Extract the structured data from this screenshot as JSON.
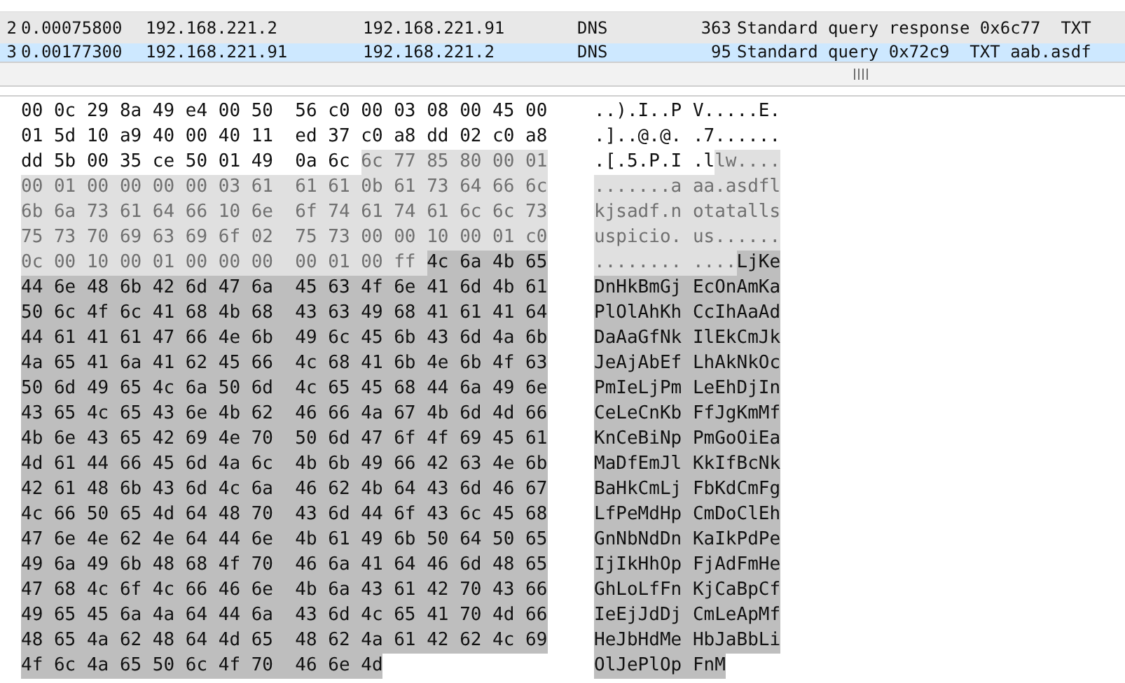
{
  "packet_list": {
    "rows": [
      {
        "no": "2",
        "time": "0.00075800",
        "source": "192.168.221.2",
        "destination": "192.168.221.91",
        "protocol": "DNS",
        "length": "363",
        "info": "Standard query response 0x6c77  TXT",
        "selected": false
      },
      {
        "no": "3",
        "time": "0.00177300",
        "source": "192.168.221.91",
        "destination": "192.168.221.2",
        "protocol": "DNS",
        "length": "95",
        "info": "Standard query 0x72c9  TXT aab.asdf",
        "selected": true
      }
    ]
  },
  "hex_dump": {
    "rows": [
      {
        "hex": [
          {
            "text": "00 0c 29 8a 49 e4 00 50  56 c0 00 03 08 00 45 00",
            "kind": "plain"
          }
        ],
        "ascii": [
          {
            "text": "..).I..P V.....E.",
            "kind": "plain"
          }
        ]
      },
      {
        "hex": [
          {
            "text": "01 5d 10 a9 40 00 40 11  ed 37 c0 a8 dd 02 c0 a8",
            "kind": "plain"
          }
        ],
        "ascii": [
          {
            "text": ".]..@.@. .7......",
            "kind": "plain"
          }
        ]
      },
      {
        "hex": [
          {
            "text": "dd 5b 00 35 ce 50 01 49  0a 6c ",
            "kind": "plain"
          },
          {
            "text": "6c 77 85 80 00 01",
            "kind": "field"
          }
        ],
        "ascii": [
          {
            "text": ".[.5.P.I .l",
            "kind": "plain"
          },
          {
            "text": "lw....",
            "kind": "field"
          }
        ]
      },
      {
        "hex": [
          {
            "text": "00 01 00 00 00 00 03 61  61 61 0b 61 73 64 66 6c",
            "kind": "field"
          }
        ],
        "ascii": [
          {
            "text": ".......a aa.asdfl",
            "kind": "field"
          }
        ]
      },
      {
        "hex": [
          {
            "text": "6b 6a 73 61 64 66 10 6e  6f 74 61 74 61 6c 6c 73",
            "kind": "field"
          }
        ],
        "ascii": [
          {
            "text": "kjsadf.n otatalls",
            "kind": "field"
          }
        ]
      },
      {
        "hex": [
          {
            "text": "75 73 70 69 63 69 6f 02  75 73 00 00 10 00 01 c0",
            "kind": "field"
          }
        ],
        "ascii": [
          {
            "text": "uspicio. us......",
            "kind": "field"
          }
        ]
      },
      {
        "hex": [
          {
            "text": "0c 00 10 00 01 00 00 00  00 01 00 ff ",
            "kind": "field"
          },
          {
            "text": "4c 6a 4b 65",
            "kind": "selected"
          }
        ],
        "ascii": [
          {
            "text": "........ ....",
            "kind": "field"
          },
          {
            "text": "LjKe",
            "kind": "selected"
          }
        ]
      },
      {
        "hex": [
          {
            "text": "44 6e 48 6b 42 6d 47 6a  45 63 4f 6e 41 6d 4b 61",
            "kind": "selected"
          }
        ],
        "ascii": [
          {
            "text": "DnHkBmGj EcOnAmKa",
            "kind": "selected"
          }
        ]
      },
      {
        "hex": [
          {
            "text": "50 6c 4f 6c 41 68 4b 68  43 63 49 68 41 61 41 64",
            "kind": "selected"
          }
        ],
        "ascii": [
          {
            "text": "PlOlAhKh CcIhAaAd",
            "kind": "selected"
          }
        ]
      },
      {
        "hex": [
          {
            "text": "44 61 41 61 47 66 4e 6b  49 6c 45 6b 43 6d 4a 6b",
            "kind": "selected"
          }
        ],
        "ascii": [
          {
            "text": "DaAaGfNk IlEkCmJk",
            "kind": "selected"
          }
        ]
      },
      {
        "hex": [
          {
            "text": "4a 65 41 6a 41 62 45 66  4c 68 41 6b 4e 6b 4f 63",
            "kind": "selected"
          }
        ],
        "ascii": [
          {
            "text": "JeAjAbEf LhAkNkOc",
            "kind": "selected"
          }
        ]
      },
      {
        "hex": [
          {
            "text": "50 6d 49 65 4c 6a 50 6d  4c 65 45 68 44 6a 49 6e",
            "kind": "selected"
          }
        ],
        "ascii": [
          {
            "text": "PmIeLjPm LeEhDjIn",
            "kind": "selected"
          }
        ]
      },
      {
        "hex": [
          {
            "text": "43 65 4c 65 43 6e 4b 62  46 66 4a 67 4b 6d 4d 66",
            "kind": "selected"
          }
        ],
        "ascii": [
          {
            "text": "CeLeCnKb FfJgKmMf",
            "kind": "selected"
          }
        ]
      },
      {
        "hex": [
          {
            "text": "4b 6e 43 65 42 69 4e 70  50 6d 47 6f 4f 69 45 61",
            "kind": "selected"
          }
        ],
        "ascii": [
          {
            "text": "KnCeBiNp PmGoOiEa",
            "kind": "selected"
          }
        ]
      },
      {
        "hex": [
          {
            "text": "4d 61 44 66 45 6d 4a 6c  4b 6b 49 66 42 63 4e 6b",
            "kind": "selected"
          }
        ],
        "ascii": [
          {
            "text": "MaDfEmJl KkIfBcNk",
            "kind": "selected"
          }
        ]
      },
      {
        "hex": [
          {
            "text": "42 61 48 6b 43 6d 4c 6a  46 62 4b 64 43 6d 46 67",
            "kind": "selected"
          }
        ],
        "ascii": [
          {
            "text": "BaHkCmLj FbKdCmFg",
            "kind": "selected"
          }
        ]
      },
      {
        "hex": [
          {
            "text": "4c 66 50 65 4d 64 48 70  43 6d 44 6f 43 6c 45 68",
            "kind": "selected"
          }
        ],
        "ascii": [
          {
            "text": "LfPeMdHp CmDoClEh",
            "kind": "selected"
          }
        ]
      },
      {
        "hex": [
          {
            "text": "47 6e 4e 62 4e 64 44 6e  4b 61 49 6b 50 64 50 65",
            "kind": "selected"
          }
        ],
        "ascii": [
          {
            "text": "GnNbNdDn KaIkPdPe",
            "kind": "selected"
          }
        ]
      },
      {
        "hex": [
          {
            "text": "49 6a 49 6b 48 68 4f 70  46 6a 41 64 46 6d 48 65",
            "kind": "selected"
          }
        ],
        "ascii": [
          {
            "text": "IjIkHhOp FjAdFmHe",
            "kind": "selected"
          }
        ]
      },
      {
        "hex": [
          {
            "text": "47 68 4c 6f 4c 66 46 6e  4b 6a 43 61 42 70 43 66",
            "kind": "selected"
          }
        ],
        "ascii": [
          {
            "text": "GhLoLfFn KjCaBpCf",
            "kind": "selected"
          }
        ]
      },
      {
        "hex": [
          {
            "text": "49 65 45 6a 4a 64 44 6a  43 6d 4c 65 41 70 4d 66",
            "kind": "selected"
          }
        ],
        "ascii": [
          {
            "text": "IeEjJdDj CmLeApMf",
            "kind": "selected"
          }
        ]
      },
      {
        "hex": [
          {
            "text": "48 65 4a 62 48 64 4d 65  48 62 4a 61 42 62 4c 69",
            "kind": "selected"
          }
        ],
        "ascii": [
          {
            "text": "HeJbHdMe HbJaBbLi",
            "kind": "selected"
          }
        ]
      },
      {
        "hex": [
          {
            "text": "4f 6c 4a 65 50 6c 4f 70  46 6e 4d",
            "kind": "selected"
          }
        ],
        "ascii": [
          {
            "text": "OlJePlOp FnM",
            "kind": "selected"
          }
        ]
      }
    ]
  }
}
